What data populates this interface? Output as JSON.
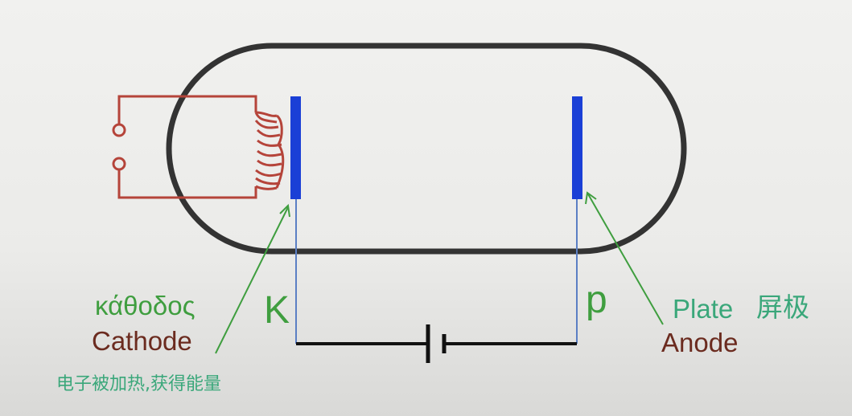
{
  "labels": {
    "cathode_greek": "κάθοδος",
    "cathode_en": "Cathode",
    "cathode_zh": "电子被加热,获得能量",
    "k_letter": "K",
    "p_letter": "p",
    "plate_en": "Plate",
    "plate_zh": "屏极",
    "anode_en": "Anode"
  },
  "colors": {
    "tube_outline": "#333333",
    "electrode": "#1a3fd6",
    "wire": "#5b7fc4",
    "heater": "#b5443a",
    "pointer": "#3f9e3f",
    "green_text": "#3f9e3f",
    "brown_text": "#6b2b1f",
    "teal_text": "#3aa77a",
    "battery": "#111111"
  }
}
